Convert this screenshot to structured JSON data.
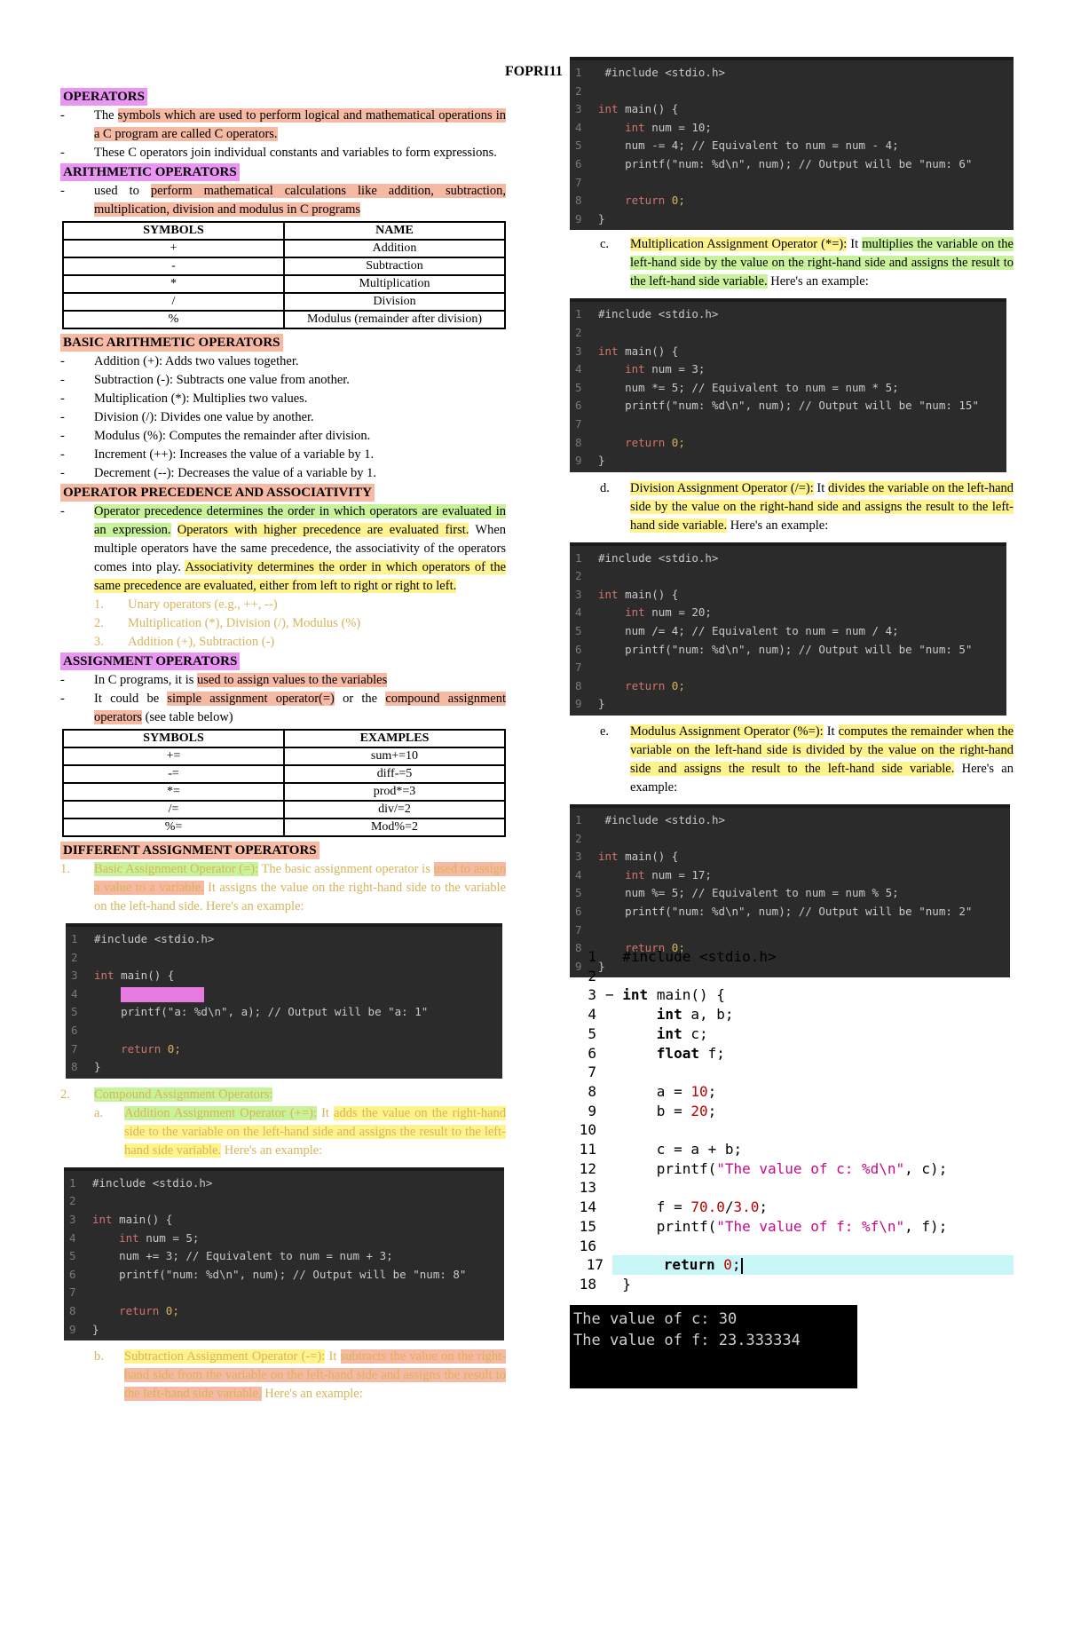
{
  "course_code": "FOPRI11",
  "operators": {
    "heading": "OPERATORS",
    "b1_pre": "The ",
    "b1_hl": "symbols which are used to perform logical and mathematical operations in a C program are called C operators.",
    "b2": "These C operators join individual constants and variables to form expressions."
  },
  "arithmetic": {
    "heading": "ARITHMETIC OPERATORS",
    "b1_pre": "used to ",
    "b1_hl": "perform mathematical calculations like addition, subtraction, multiplication, division and modulus in C programs",
    "table_headers": [
      "SYMBOLS",
      "NAME"
    ],
    "rows": [
      [
        "+",
        "Addition"
      ],
      [
        "-",
        "Subtraction"
      ],
      [
        "*",
        "Multiplication"
      ],
      [
        "/",
        "Division"
      ],
      [
        "%",
        "Modulus (remainder after division)"
      ]
    ]
  },
  "basic_arith": {
    "heading": "BASIC ARITHMETIC OPERATORS",
    "items": [
      "Addition (+): Adds two values together.",
      "Subtraction (-): Subtracts one value from another.",
      "Multiplication (*): Multiplies two values.",
      "Division (/): Divides one value by another.",
      "Modulus (%): Computes the remainder after division.",
      "Increment (++): Increases the value of a variable by 1.",
      "Decrement (--): Decreases the value of a variable by 1."
    ]
  },
  "precedence": {
    "heading": "OPERATOR PRECEDENCE AND ASSOCIATIVITY",
    "s1": "Operator precedence determines the order in which operators are evaluated in an expression.",
    "s2": "Operators with higher precedence are evaluated first.",
    "s3": "When multiple operators have the same precedence, the associativity of the operators comes into play.",
    "s4": "Associativity determines the order in which operators of the same precedence are evaluated, either from left to right or right to left.",
    "list": [
      {
        "n": "1.",
        "t": "Unary operators (e.g., ++, --)"
      },
      {
        "n": "2.",
        "t": "Multiplication (*), Division (/), Modulus (%)"
      },
      {
        "n": "3.",
        "t": "Addition (+), Subtraction (-)"
      }
    ]
  },
  "assignment": {
    "heading": "ASSIGNMENT OPERATORS",
    "b1_pre": "In C programs, it is ",
    "b1_hl": "used to assign values to the variables",
    "b2_pre": "It could be ",
    "b2_hl1": "simple assignment operator(=)",
    "b2_mid": " or the ",
    "b2_hl2": "compound assignment operators",
    "b2_post": " (see table below)",
    "table_headers": [
      "SYMBOLS",
      "EXAMPLES"
    ],
    "rows": [
      [
        "+=",
        "sum+=10"
      ],
      [
        "-=",
        "diff-=5"
      ],
      [
        "*=",
        "prod*=3"
      ],
      [
        "/=",
        "div/=2"
      ],
      [
        "%=",
        "Mod%=2"
      ]
    ]
  },
  "diff_assign": {
    "heading": "DIFFERENT ASSIGNMENT OPERATORS",
    "item1_num": "1.",
    "item1_title": "Basic Assignment Operator (=):",
    "item1_pre": " The basic assignment operator is ",
    "item1_hl": "used to assign a value to a variable.",
    "item1_post": " It assigns the value on the right-hand side to the variable on the left-hand side. Here's an example:",
    "item2_num": "2.",
    "item2_title": "Compound Assignment Operators:",
    "a_lbl": "a.",
    "a_title": "Addition Assignment Operator (+=):",
    "a_pre": " It ",
    "a_hl": "adds the value on the right-hand side to the variable on the left-hand side and assigns the result to the left-hand side variable.",
    "a_post": " Here's an example:",
    "b_lbl": "b.",
    "b_title": "Subtraction Assignment Operator (-=):",
    "b_pre": " It ",
    "b_hl": "subtracts the value on the right-hand side from the variable on the left-hand side and assigns the result to the left-hand side variable.",
    "b_post": " Here's an example:",
    "c_lbl": "c.",
    "c_title": "Multiplication Assignment Operator (*=):",
    "c_pre": " It ",
    "c_hl": "multiplies the variable on the left-hand side by the value on the right-hand side and assigns the result to the left-hand side variable.",
    "c_post": " Here's an example:",
    "d_lbl": "d.",
    "d_title": "Division Assignment Operator (/=):",
    "d_pre": " It ",
    "d_hl": "divides the variable on the left-hand side by the value on the right-hand side and assigns the result to the left-hand side variable.",
    "d_post": " Here's an example:",
    "e_lbl": "e.",
    "e_title": "Modulus Assignment Operator (%=):",
    "e_pre": " It ",
    "e_hl": "computes the remainder when the variable on the left-hand side is divided by the value on the right-hand side and assigns the result to the left-hand side variable.",
    "e_post": " Here's an example:"
  },
  "code_snippets": {
    "include": "#include <stdio.h>",
    "main": "main() {",
    "int_kw": "int",
    "return_kw": "return",
    "return_val": "0;",
    "close": "}",
    "basic_printf": "printf(\"a: %d\\n\", a); // Output will be \"a: 1\"",
    "sub_decl": " num = 10;",
    "sub_op": "num -= 4; // Equivalent to num = num - 4;",
    "sub_printf": "printf(\"num: %d\\n\", num); // Output will be \"num: 6\"",
    "mul_decl": " num = 3;",
    "mul_op": "num *= 5; // Equivalent to num = num * 5;",
    "mul_printf": "printf(\"num: %d\\n\", num); // Output will be \"num: 15\"",
    "div_decl": " num = 20;",
    "div_op": "num /= 4; // Equivalent to num = num / 4;",
    "div_printf": "printf(\"num: %d\\n\", num); // Output will be \"num: 5\"",
    "mod_decl": " num = 17;",
    "mod_op": "num %= 5; // Equivalent to num = num % 5;",
    "mod_printf": "printf(\"num: %d\\n\", num); // Output will be \"num: 2\"",
    "add_decl": " num = 5;",
    "add_op": "num += 3; // Equivalent to num = num + 3;",
    "add_printf": "printf(\"num: %d\\n\", num); // Output will be \"num: 8\""
  },
  "ide_program": {
    "lines": [
      "#include <stdio.h>",
      "",
      "int main() {",
      "    int a, b;",
      "    int c;",
      "    float f;",
      "",
      "    a = 10;",
      "    b = 20;",
      "",
      "    c = a + b;",
      "    printf(\"The value of c: %d\\n\", c);",
      "",
      "    f = 70.0/3.0;",
      "    printf(\"The value of f: %f\\n\", f);",
      "",
      "    return 0;",
      "}"
    ],
    "line_numbers": [
      "1",
      "2",
      "3",
      "4",
      "5",
      "6",
      "7",
      "8",
      "9",
      "10",
      "11",
      "12",
      "13",
      "14",
      "15",
      "16",
      "17",
      "18"
    ],
    "fold_marker": "−"
  },
  "terminal": {
    "lines": [
      "The value of c: 30",
      "The value of f: 23.333334"
    ]
  },
  "colors": {
    "heading_pink": "#e996f2",
    "highlight_salmon": "#f6b9a4",
    "highlight_yellow": "#fff38d",
    "highlight_green": "#c9f39b",
    "code_bg": "#2b2b2b",
    "ide_current_line": "#c8f5f5"
  }
}
